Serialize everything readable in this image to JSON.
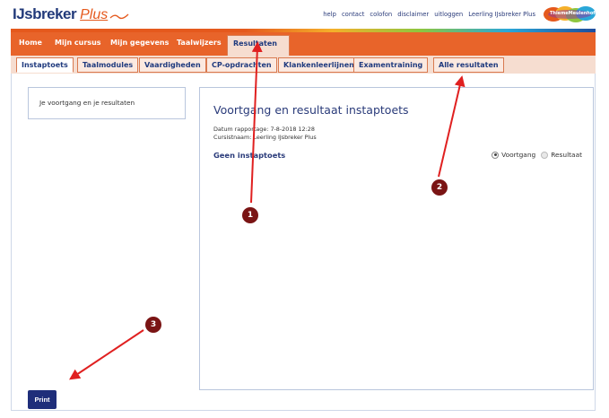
{
  "header": {
    "logo_part1": "IJsbreker",
    "logo_part2": "Plus",
    "links": [
      "help",
      "contact",
      "colofon",
      "disclaimer",
      "uitloggen",
      "Leerling IJsbreker Plus"
    ],
    "badge_text": "ThiemeMeulenhoff",
    "stripe_colors": [
      "#e5591d",
      "#f5b02a",
      "#8ec63f",
      "#2aa7d8",
      "#1f4d9c"
    ]
  },
  "mainnav": {
    "items": [
      "Home",
      "Mijn cursus",
      "Mijn gegevens",
      "Taalwijzers"
    ],
    "active": "Resultaten",
    "color": "#e8642a"
  },
  "subnav": {
    "tabs": [
      "Instaptoets",
      "Taalmodules",
      "Vaardigheden",
      "CP-opdrachten",
      "Klankenleerlijnen",
      "Examentraining",
      "Alle resultaten"
    ]
  },
  "sidebar": {
    "item": "Je voortgang en je resultaten"
  },
  "content": {
    "title": "Voortgang en resultaat instaptoets",
    "date_line": "Datum rapportage: 7-8-2018 12:28",
    "course_line": "Cursistnaam: Leerling IJsbreker Plus",
    "status": "Geen instaptoets",
    "radio_options": [
      "Voortgang",
      "Resultaat"
    ],
    "radio_selected": "Voortgang"
  },
  "print_label": "Print",
  "annotations": {
    "markers": [
      "1",
      "2",
      "3"
    ],
    "arrow_color": "#e02020"
  }
}
